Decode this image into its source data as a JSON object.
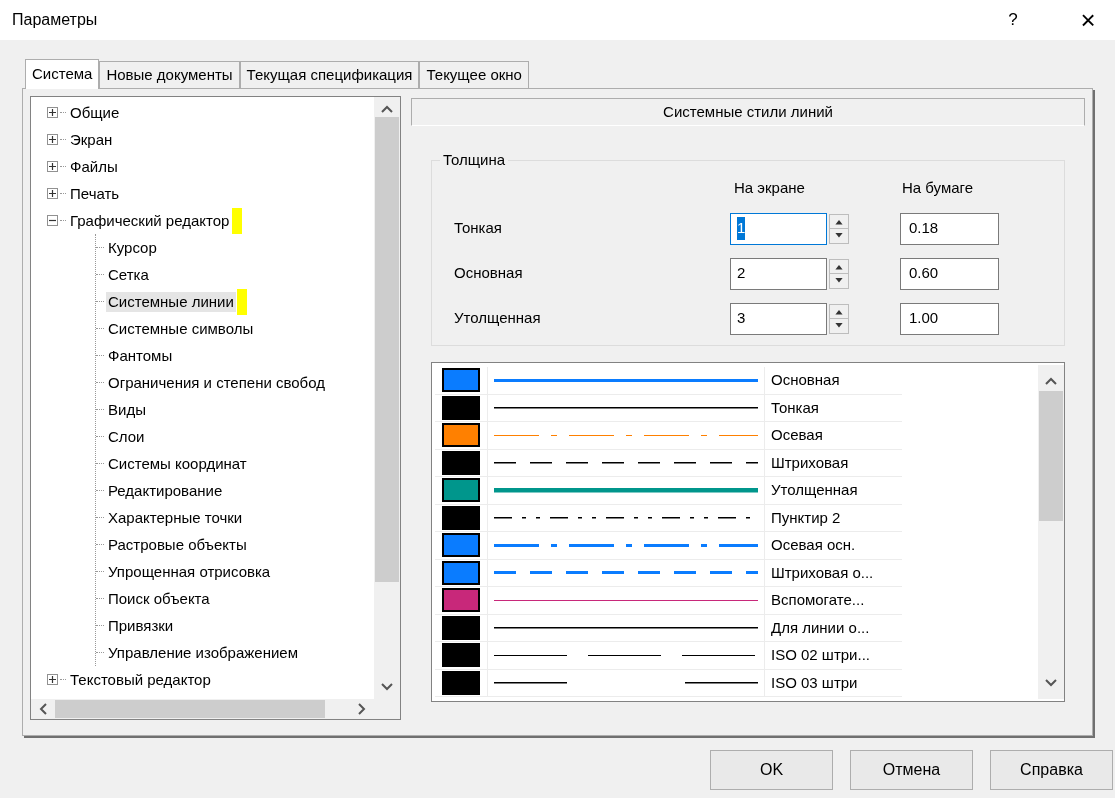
{
  "window": {
    "title": "Параметры",
    "help": "?",
    "close": "×"
  },
  "tabs": [
    {
      "label": "Система",
      "selected": true
    },
    {
      "label": "Новые документы",
      "selected": false
    },
    {
      "label": "Текущая спецификация",
      "selected": false
    },
    {
      "label": "Текущее окно",
      "selected": false
    }
  ],
  "tree": [
    {
      "label": "Общие",
      "expanded": false,
      "selected": false,
      "highlighted": false
    },
    {
      "label": "Экран",
      "expanded": false,
      "selected": false,
      "highlighted": false
    },
    {
      "label": "Файлы",
      "expanded": false,
      "selected": false,
      "highlighted": false
    },
    {
      "label": "Печать",
      "expanded": false,
      "selected": false,
      "highlighted": false
    },
    {
      "label": "Графический редактор",
      "expanded": true,
      "selected": false,
      "highlighted": true,
      "children": [
        {
          "label": "Курсор",
          "selected": false,
          "highlighted": false
        },
        {
          "label": "Сетка",
          "selected": false,
          "highlighted": false
        },
        {
          "label": "Системные линии",
          "selected": true,
          "highlighted": true
        },
        {
          "label": "Системные символы",
          "selected": false,
          "highlighted": false
        },
        {
          "label": "Фантомы",
          "selected": false,
          "highlighted": false
        },
        {
          "label": "Ограничения и степени свобод",
          "selected": false,
          "highlighted": false
        },
        {
          "label": "Виды",
          "selected": false,
          "highlighted": false
        },
        {
          "label": "Слои",
          "selected": false,
          "highlighted": false
        },
        {
          "label": "Системы координат",
          "selected": false,
          "highlighted": false
        },
        {
          "label": "Редактирование",
          "selected": false,
          "highlighted": false
        },
        {
          "label": "Характерные точки",
          "selected": false,
          "highlighted": false
        },
        {
          "label": "Растровые объекты",
          "selected": false,
          "highlighted": false
        },
        {
          "label": "Упрощенная отрисовка",
          "selected": false,
          "highlighted": false
        },
        {
          "label": "Поиск объекта",
          "selected": false,
          "highlighted": false
        },
        {
          "label": "Привязки",
          "selected": false,
          "highlighted": false
        },
        {
          "label": "Управление изображением",
          "selected": false,
          "highlighted": false
        }
      ]
    },
    {
      "label": "Текстовый редактор",
      "expanded": false,
      "selected": false,
      "highlighted": false
    }
  ],
  "panel": {
    "title": "Системные стили линий",
    "thickness": {
      "title": "Толщина",
      "column_screen": "На экране",
      "column_paper": "На бумаге",
      "rows": [
        {
          "label": "Тонкая",
          "screen": "1",
          "paper": "0.18",
          "focused": true
        },
        {
          "label": "Основная",
          "screen": "2",
          "paper": "0.60",
          "focused": false
        },
        {
          "label": "Утолщенная",
          "screen": "3",
          "paper": "1.00",
          "focused": false
        }
      ]
    },
    "styles": [
      {
        "name": "Основная",
        "color": "#0a7cff",
        "kind": "main"
      },
      {
        "name": "Тонкая",
        "color": "#000000",
        "kind": "thin"
      },
      {
        "name": "Осевая",
        "color": "#ff8000",
        "kind": "axial"
      },
      {
        "name": "Штриховая",
        "color": "#000000",
        "kind": "dashed"
      },
      {
        "name": "Утолщенная",
        "color": "#00968c",
        "kind": "thick"
      },
      {
        "name": "Пунктир 2",
        "color": "#000000",
        "kind": "dashdotdot"
      },
      {
        "name": "Осевая осн.",
        "color": "#0a7cff",
        "kind": "axialmain"
      },
      {
        "name": "Штриховая о...",
        "color": "#0a7cff",
        "kind": "dashedmain"
      },
      {
        "name": "Вспомогате...",
        "color": "#c8287a",
        "kind": "thin"
      },
      {
        "name": "Для линии о...",
        "color": "#000000",
        "kind": "thin"
      },
      {
        "name": "ISO 02 штри...",
        "color": "#000000",
        "kind": "iso02"
      },
      {
        "name": "ISO 03 штри",
        "color": "#000000",
        "kind": "iso03"
      }
    ]
  },
  "buttons": [
    "OK",
    "Отмена",
    "Справка"
  ]
}
